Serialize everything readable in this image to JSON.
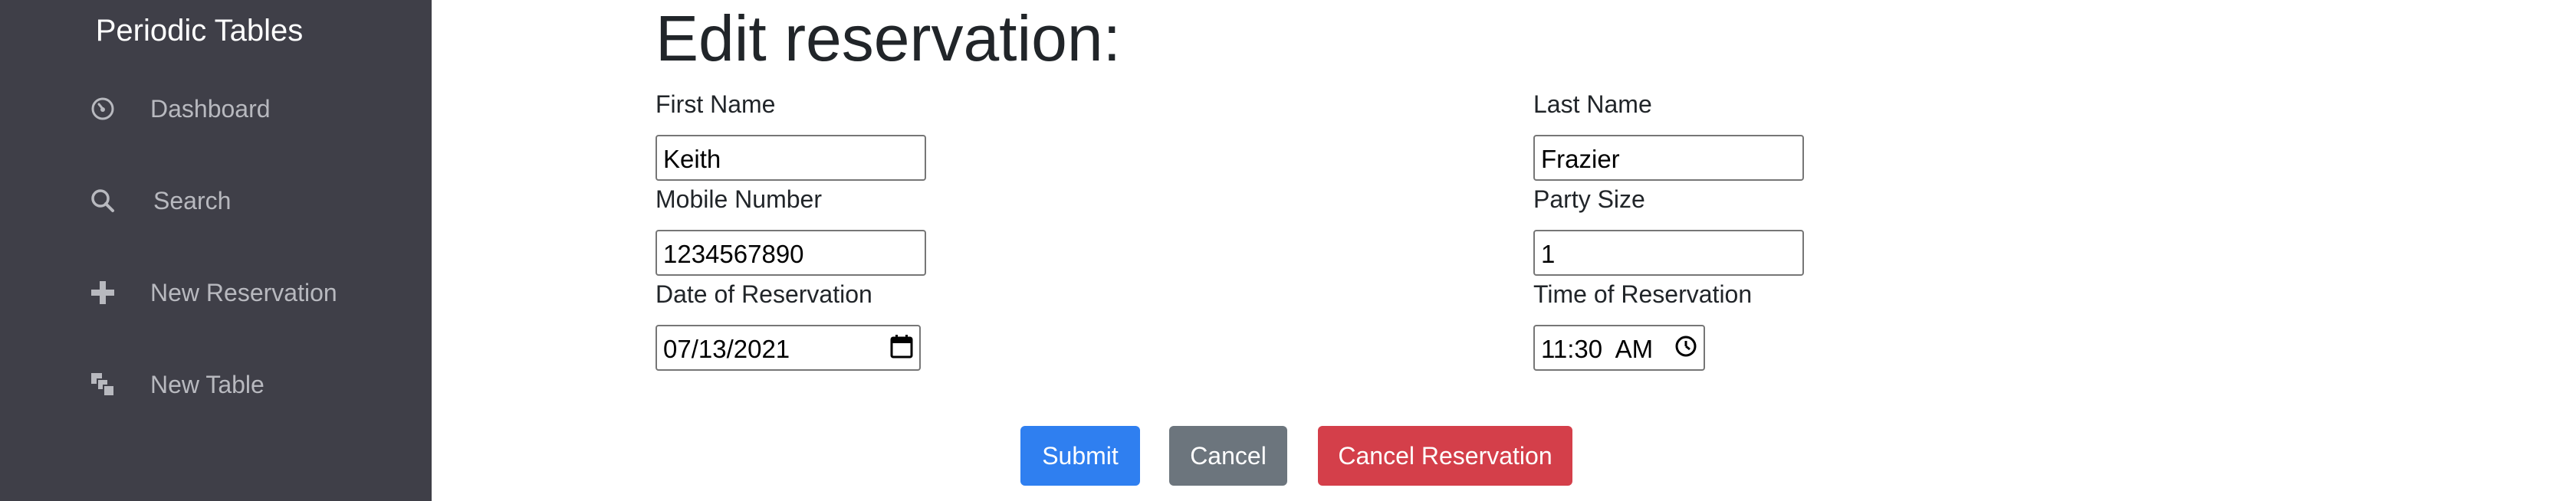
{
  "sidebar": {
    "brand": "Periodic Tables",
    "items": [
      {
        "label": "Dashboard",
        "icon": "dashboard-icon"
      },
      {
        "label": "Search",
        "icon": "search-icon"
      },
      {
        "label": "New Reservation",
        "icon": "plus-icon"
      },
      {
        "label": "New Table",
        "icon": "table-icon"
      }
    ]
  },
  "form": {
    "title": "Edit reservation:",
    "first_name": {
      "label": "First Name",
      "value": "Keith"
    },
    "last_name": {
      "label": "Last Name",
      "value": "Frazier"
    },
    "mobile_number": {
      "label": "Mobile Number",
      "value": "1234567890"
    },
    "party_size": {
      "label": "Party Size",
      "value": "1"
    },
    "reservation_date": {
      "label": "Date of Reservation",
      "value": "07/13/2021"
    },
    "reservation_time": {
      "label": "Time of Reservation",
      "value": "11:30  AM"
    }
  },
  "buttons": {
    "submit": "Submit",
    "cancel": "Cancel",
    "cancel_reservation": "Cancel Reservation"
  },
  "colors": {
    "sidebar_bg": "#3f3f48",
    "submit_bg": "#2f7ff0",
    "cancel_bg": "#6c757d",
    "cancel_reservation_bg": "#d43f4a"
  }
}
